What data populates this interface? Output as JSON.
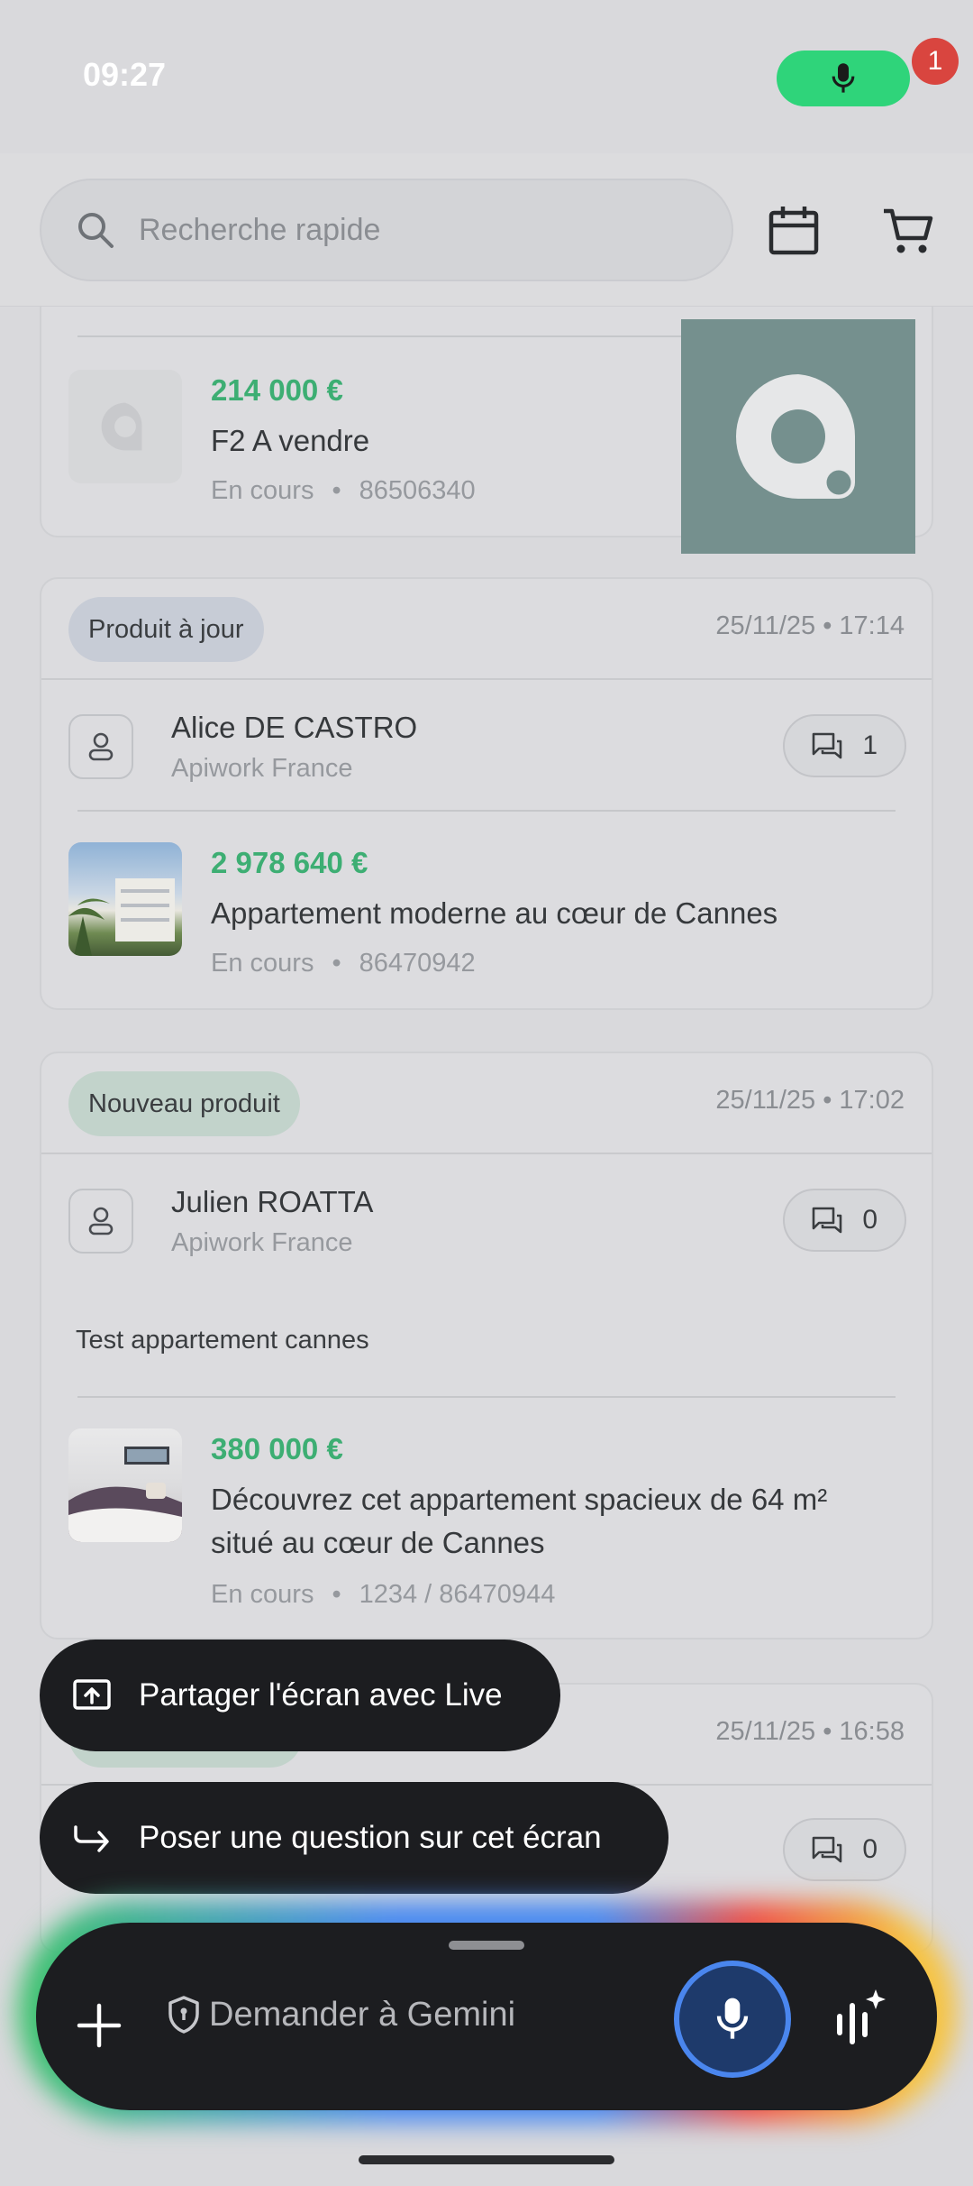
{
  "status_bar": {
    "time": "09:27"
  },
  "header": {
    "search_placeholder": "Recherche rapide",
    "cart_count": "1"
  },
  "cards": [
    {
      "price": "214 000 €",
      "title": "F2 A vendre",
      "status": "En cours",
      "reference": "86506340"
    },
    {
      "tag": "Produit à jour",
      "date": "25/11/25 • 17:14",
      "person_name": "Alice DE CASTRO",
      "company": "Apiwork France",
      "comment_count": "1",
      "price": "2 978 640 €",
      "title": "Appartement moderne au cœur de Cannes",
      "status": "En cours",
      "reference": "86470942"
    },
    {
      "tag": "Nouveau produit",
      "date": "25/11/25 • 17:02",
      "person_name": "Julien ROATTA",
      "company": "Apiwork France",
      "comment_count": "0",
      "note": "Test appartement cannes",
      "price": "380 000 €",
      "title_line1": "Découvrez cet appartement spacieux de 64 m²",
      "title_line2": "situé au cœur de Cannes",
      "status": "En cours",
      "reference": "1234 / 86470944"
    },
    {
      "date": "25/11/25 • 16:58",
      "comment_count": "0"
    }
  ],
  "gemini": {
    "share_screen_label": "Partager l'écran avec Live",
    "ask_screen_label": "Poser une question sur cet écran",
    "input_placeholder": "Demander à Gemini"
  },
  "colors": {
    "price_green": "#3dae73",
    "mic_active_green": "#2fd47a",
    "badge_red": "#d9453f"
  }
}
